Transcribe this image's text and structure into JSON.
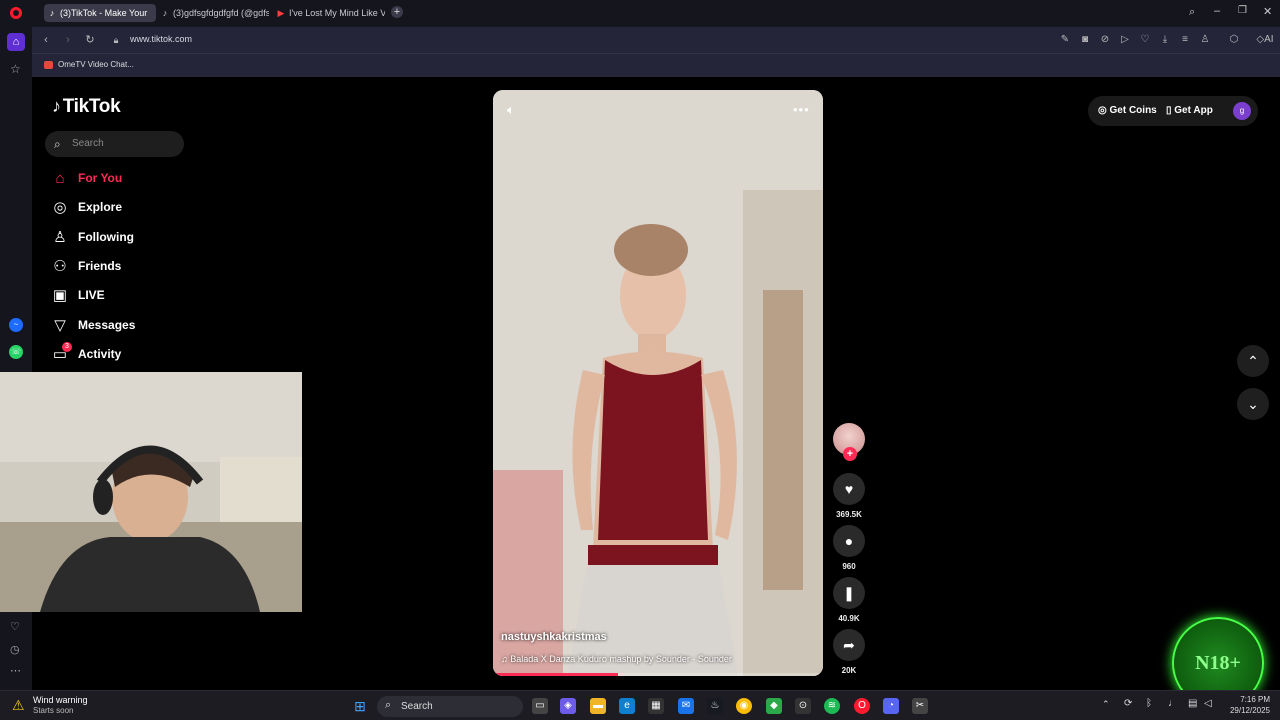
{
  "browser": {
    "tabs": [
      {
        "label": "(3)TikTok - Make Your",
        "active": true,
        "icon": "tiktok-icon"
      },
      {
        "label": "(3)gdfsgfdgdfgfd (@gdfs",
        "active": false,
        "icon": "tiktok-icon"
      },
      {
        "label": "I've Lost My Mind Like Vir",
        "active": false,
        "icon": "youtube-icon"
      }
    ],
    "url": "www.tiktok.com",
    "bookmark": "OmeTV Video Chat..."
  },
  "sidebar": {
    "logo": "TikTok",
    "search_placeholder": "Search",
    "items": [
      {
        "label": "For You",
        "icon": "home-icon",
        "active": true
      },
      {
        "label": "Explore",
        "icon": "compass-icon",
        "active": false
      },
      {
        "label": "Following",
        "icon": "user-follow-icon",
        "active": false
      },
      {
        "label": "Friends",
        "icon": "friends-icon",
        "active": false
      },
      {
        "label": "LIVE",
        "icon": "live-icon",
        "active": false
      },
      {
        "label": "Messages",
        "icon": "send-icon",
        "active": false
      },
      {
        "label": "Activity",
        "icon": "inbox-icon",
        "active": false,
        "badge": "3"
      }
    ]
  },
  "video": {
    "username": "nastuyshkakristmas",
    "music": "Balada X Danza Kuduro mashup by Sounder - Sounder",
    "progress": 0.38
  },
  "actions": {
    "likes": "369.5K",
    "comments": "960",
    "saves": "40.9K",
    "shares": "20K"
  },
  "topbar": {
    "get_coins": "Get Coins",
    "get_app": "Get App",
    "avatar_letter": "g"
  },
  "overlay": {
    "badge_text": "N18+"
  },
  "taskbar": {
    "weather_title": "Wind warning",
    "weather_sub": "Starts soon",
    "search": "Search",
    "time": "7:16 PM",
    "date": "29/12/2025"
  }
}
